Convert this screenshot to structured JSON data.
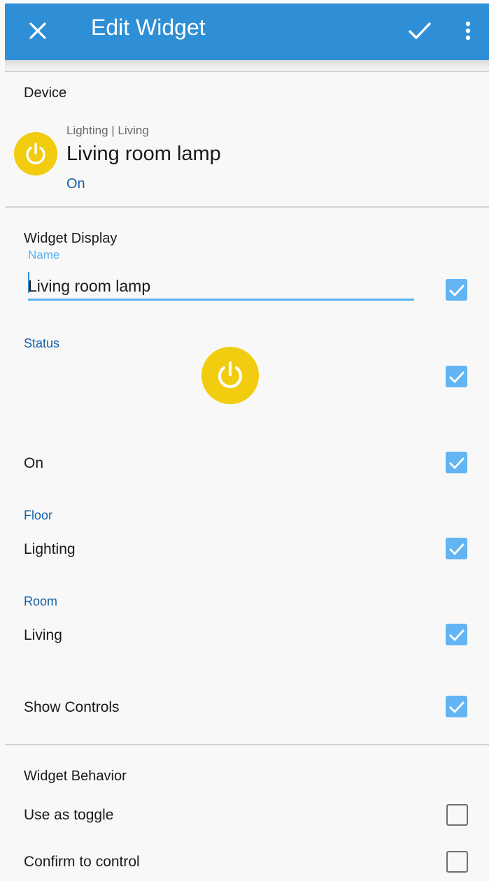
{
  "appbar": {
    "title": "Edit Widget",
    "close_icon": "close-icon",
    "confirm_icon": "check-icon",
    "menu_icon": "more-vert-icon",
    "color": "#2f8fd6"
  },
  "device": {
    "section_label": "Device",
    "breadcrumb": "Lighting | Living",
    "name": "Living room lamp",
    "state": "On",
    "icon": "power-icon",
    "icon_color": "#f2cc0e"
  },
  "widget_display": {
    "section_label": "Widget Display",
    "name_label": "Name",
    "name_value": "Living room lamp",
    "name_checked": true,
    "status_label": "Status",
    "status_icon_checked": true,
    "status_value": "On",
    "status_value_checked": true,
    "floor_label": "Floor",
    "floor_value": "Lighting",
    "floor_checked": true,
    "room_label": "Room",
    "room_value": "Living",
    "room_checked": true,
    "show_controls_label": "Show Controls",
    "show_controls_checked": true
  },
  "widget_behavior": {
    "section_label": "Widget Behavior",
    "use_as_toggle_label": "Use as toggle",
    "use_as_toggle_checked": false,
    "confirm_label": "Confirm to control",
    "confirm_checked": false
  }
}
